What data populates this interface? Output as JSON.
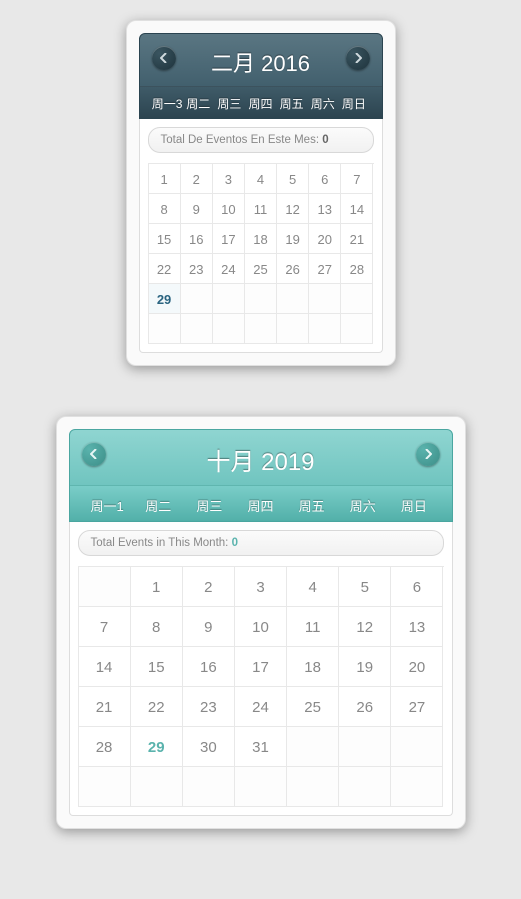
{
  "calendars": [
    {
      "id": "cal1",
      "title": "二月 2016",
      "days_header": [
        "周一3",
        "周二",
        "周三",
        "周四",
        "周五",
        "周六",
        "周日"
      ],
      "summary_label": "Total De Eventos En Este Mes: ",
      "summary_count": "0",
      "leading_empty": 0,
      "days_in_month": 29,
      "today": 29,
      "rows": 6
    },
    {
      "id": "cal2",
      "title": "十月 2019",
      "days_header": [
        "周一1",
        "周二",
        "周三",
        "周四",
        "周五",
        "周六",
        "周日"
      ],
      "summary_label": "Total Events in This Month: ",
      "summary_count": "0",
      "leading_empty": 1,
      "days_in_month": 31,
      "today": 29,
      "rows": 6
    }
  ]
}
